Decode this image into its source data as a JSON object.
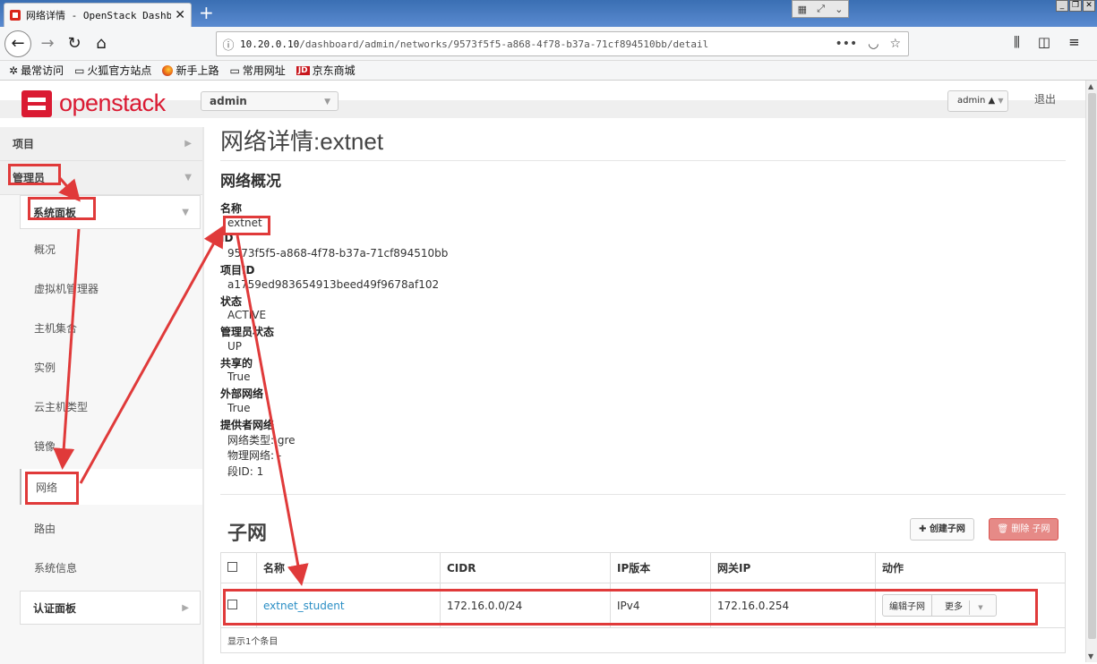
{
  "browser": {
    "tab_title": "网络详情 - OpenStack Dashboa",
    "tab_close": "✕",
    "new_tab": "+",
    "url_host": "10.20.0.10",
    "url_path": "/dashboard/admin/networks/9573f5f5-a868-4f78-b37a-71cf894510bb/detail",
    "bookmarks": [
      {
        "label": "最常访问",
        "icon": "gear-icon"
      },
      {
        "label": "火狐官方站点",
        "icon": "folder-icon"
      },
      {
        "label": "新手上路",
        "icon": "firefox-icon"
      },
      {
        "label": "常用网址",
        "icon": "folder-icon"
      },
      {
        "label": "京东商城",
        "icon": "jd-icon",
        "badge": "JD"
      }
    ]
  },
  "header": {
    "logo_text_a": "open",
    "logo_text_b": "stack",
    "project": "admin",
    "user": "admin",
    "logout": "退出"
  },
  "sidebar": {
    "project": "项目",
    "admin": "管理员",
    "system_panel": "系统面板",
    "items": [
      "概况",
      "虚拟机管理器",
      "主机集合",
      "实例",
      "云主机类型",
      "镜像",
      "网络",
      "路由",
      "系统信息"
    ],
    "auth_panel": "认证面板"
  },
  "main": {
    "title": "网络详情:extnet",
    "overview_heading": "网络概况",
    "fields": [
      {
        "term": "名称",
        "value": "extnet"
      },
      {
        "term": "ID",
        "value": "9573f5f5-a868-4f78-b37a-71cf894510bb"
      },
      {
        "term": "项目ID",
        "value": "a1759ed983654913beed49f9678af102"
      },
      {
        "term": "状态",
        "value": "ACTIVE"
      },
      {
        "term": "管理员状态",
        "value": "UP"
      },
      {
        "term": "共享的",
        "value": "True"
      },
      {
        "term": "外部网络",
        "value": "True"
      }
    ],
    "provider_term": "提供者网络",
    "provider_values": [
      "网络类型: gre",
      "物理网络: -",
      "段ID: 1"
    ],
    "subnet_heading": "子网",
    "create_subnet": "创建子网",
    "delete_subnet": "删除 子网",
    "table_headers": [
      "名称",
      "CIDR",
      "IP版本",
      "网关IP",
      "动作"
    ],
    "rows": [
      {
        "name": "extnet_student",
        "cidr": "172.16.0.0/24",
        "ip_version": "IPv4",
        "gateway": "172.16.0.254",
        "edit": "编辑子网",
        "more": "更多"
      }
    ],
    "footer": "显示1个条目"
  },
  "colors": {
    "accent": "#da1a32",
    "annotation": "#e03a3a",
    "link": "#2a8ec5"
  }
}
